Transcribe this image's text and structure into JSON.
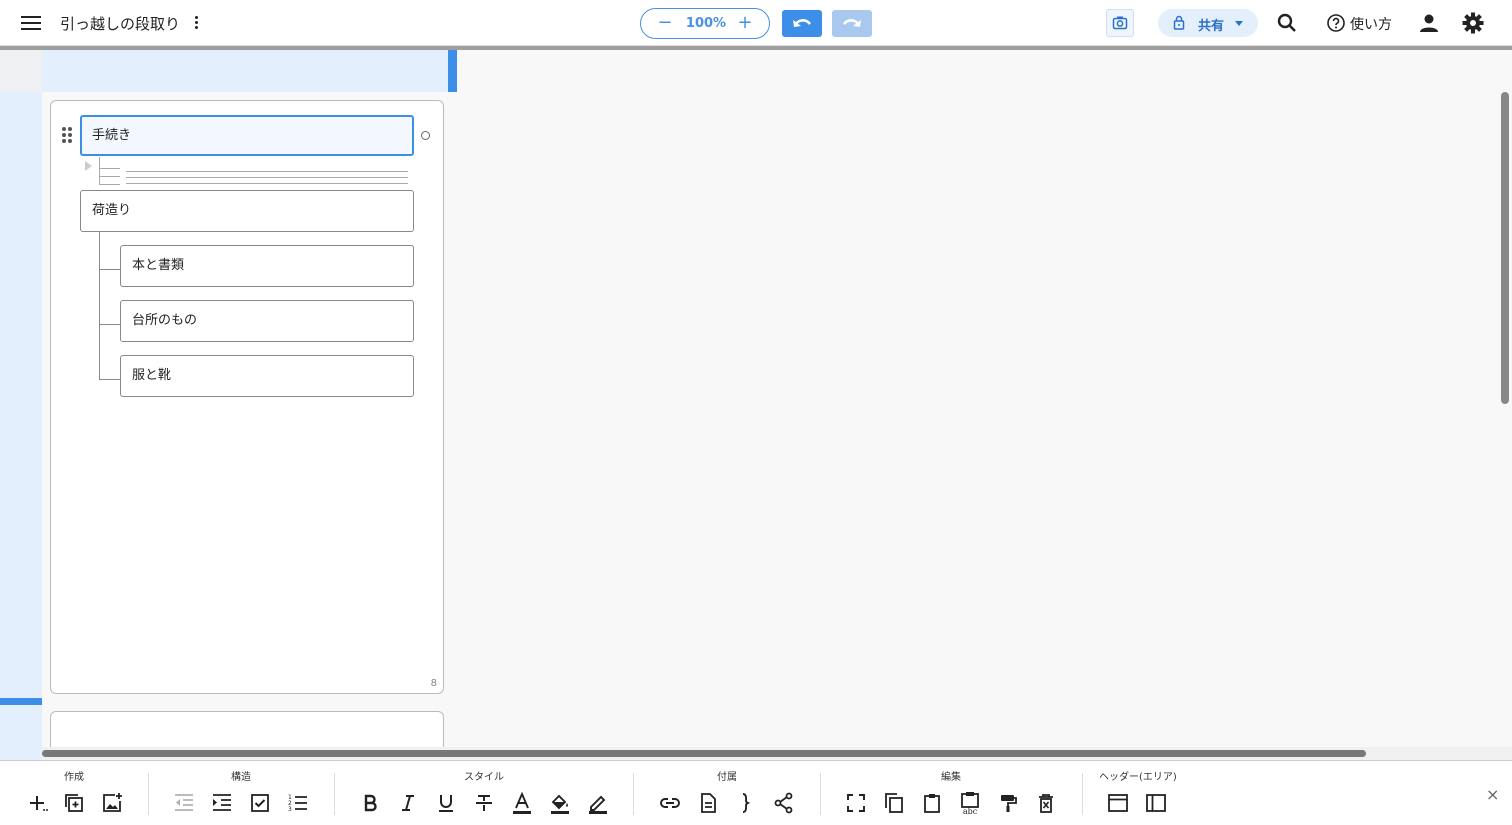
{
  "header": {
    "title": "引っ越しの段取り",
    "zoom": "100%",
    "zoom_out": "−",
    "zoom_in": "+",
    "share": "共有",
    "help": "使い方"
  },
  "outline": {
    "root": "手続き",
    "nodes": [
      {
        "label": "荷造り"
      },
      {
        "label": "本と書類"
      },
      {
        "label": "台所のもの"
      },
      {
        "label": "服と靴"
      }
    ],
    "count": "8"
  },
  "toolbar": {
    "groups": [
      "作成",
      "構造",
      "スタイル",
      "付属",
      "編集",
      "ヘッダー(エリア)"
    ],
    "close": "×"
  },
  "colors": {
    "accent": "#3d8ee8",
    "area_bg": "#e3effc"
  }
}
